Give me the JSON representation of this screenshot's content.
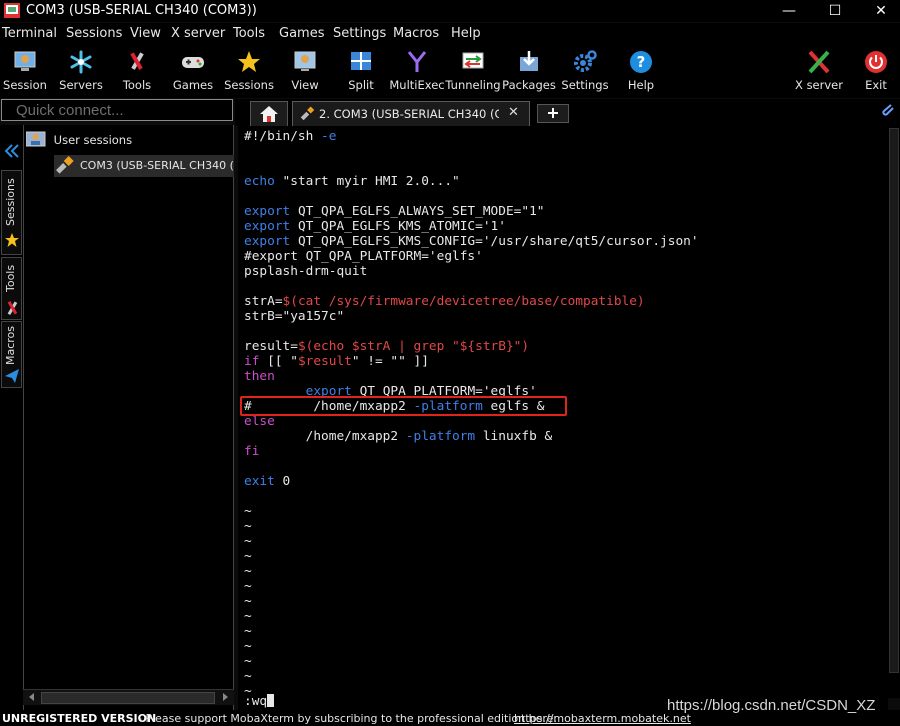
{
  "window": {
    "title": "COM3  (USB-SERIAL CH340 (COM3))",
    "minimize": "—",
    "maximize": "☐",
    "close": "✕"
  },
  "menu": [
    "Terminal",
    "Sessions",
    "View",
    "X server",
    "Tools",
    "Games",
    "Settings",
    "Macros",
    "Help"
  ],
  "toolbar": {
    "session": "Session",
    "servers": "Servers",
    "tools": "Tools",
    "games": "Games",
    "sessions": "Sessions",
    "view": "View",
    "split": "Split",
    "multiexec": "MultiExec",
    "tunneling": "Tunneling",
    "packages": "Packages",
    "settings": "Settings",
    "help": "Help",
    "xserver": "X server",
    "exit": "Exit"
  },
  "quick_connect": {
    "placeholder": "Quick connect..."
  },
  "tabs": {
    "active_label": "2. COM3  (USB-SERIAL CH340 (CO",
    "close": "✕",
    "new": "+"
  },
  "sidebar": {
    "vtabs": {
      "sessions": "Sessions",
      "tools": "Tools",
      "macros": "Macros"
    },
    "tree_root": "User sessions",
    "tree_child": "COM3  (USB-SERIAL CH340 (CO"
  },
  "terminal": {
    "lines": [
      {
        "row": 0,
        "segs": [
          [
            "w",
            "#!/bin/sh "
          ],
          [
            "b",
            "-e"
          ]
        ]
      },
      {
        "row": 3,
        "segs": [
          [
            "b",
            "echo "
          ],
          [
            "w",
            "\"start myir HMI 2.0...\""
          ]
        ]
      },
      {
        "row": 5,
        "segs": [
          [
            "b",
            "export "
          ],
          [
            "w",
            "QT_QPA_EGLFS_ALWAYS_SET_MODE=\"1\""
          ]
        ]
      },
      {
        "row": 6,
        "segs": [
          [
            "b",
            "export "
          ],
          [
            "w",
            "QT_QPA_EGLFS_KMS_ATOMIC='1'"
          ]
        ]
      },
      {
        "row": 7,
        "segs": [
          [
            "b",
            "export "
          ],
          [
            "w",
            "QT_QPA_EGLFS_KMS_CONFIG='/usr/share/qt5/cursor.json'"
          ]
        ]
      },
      {
        "row": 8,
        "segs": [
          [
            "w",
            "#export QT_QPA_PLATFORM='eglfs'"
          ]
        ]
      },
      {
        "row": 9,
        "segs": [
          [
            "w",
            "psplash-drm-quit"
          ]
        ]
      },
      {
        "row": 11,
        "segs": [
          [
            "w",
            "strA="
          ],
          [
            "r",
            "$(cat /sys/firmware/devicetree/base/compatible)"
          ]
        ]
      },
      {
        "row": 12,
        "segs": [
          [
            "w",
            "strB=\"ya157c\""
          ]
        ]
      },
      {
        "row": 14,
        "segs": [
          [
            "w",
            "result="
          ],
          [
            "r",
            "$(echo $strA | grep \"${strB}\")"
          ]
        ]
      },
      {
        "row": 15,
        "segs": [
          [
            "m",
            "if "
          ],
          [
            "w",
            "[[ \""
          ],
          [
            "r",
            "$result"
          ],
          [
            "w",
            "\" != \"\" ]]"
          ]
        ]
      },
      {
        "row": 16,
        "segs": [
          [
            "m",
            "then"
          ]
        ]
      },
      {
        "row": 17,
        "segs": [
          [
            "w",
            "        "
          ],
          [
            "b",
            "export "
          ],
          [
            "w",
            "QT_QPA_PLATFORM='eglfs'"
          ]
        ]
      },
      {
        "row": 18,
        "segs": [
          [
            "w",
            "#        /home/mxapp2 "
          ],
          [
            "b",
            "-platform "
          ],
          [
            "w",
            "eglfs &"
          ]
        ]
      },
      {
        "row": 19,
        "segs": [
          [
            "m",
            "else"
          ]
        ]
      },
      {
        "row": 20,
        "segs": [
          [
            "w",
            "        /home/mxapp2 "
          ],
          [
            "b",
            "-platform "
          ],
          [
            "w",
            "linuxfb &"
          ]
        ]
      },
      {
        "row": 21,
        "segs": [
          [
            "m",
            "fi"
          ]
        ]
      },
      {
        "row": 23,
        "segs": [
          [
            "b",
            "exit "
          ],
          [
            "w",
            "0"
          ]
        ]
      }
    ],
    "tilde": "~",
    "tilde_rows": [
      25,
      26,
      27,
      28,
      29,
      30,
      31,
      32,
      33,
      34,
      35,
      36,
      37
    ],
    "command": ":wq"
  },
  "status": {
    "unregistered": "UNREGISTERED VERSION",
    "message": "  -  Please support MobaXterm by subscribing to the professional edition here:",
    "link": "https://mobaxterm.mobatek.net"
  },
  "watermark": "https://blog.csdn.net/CSDN_XZ",
  "colors": {
    "red": "#e04848",
    "blue": "#3f7fe8",
    "magenta": "#c950c9",
    "highlight": "#e0241c"
  }
}
